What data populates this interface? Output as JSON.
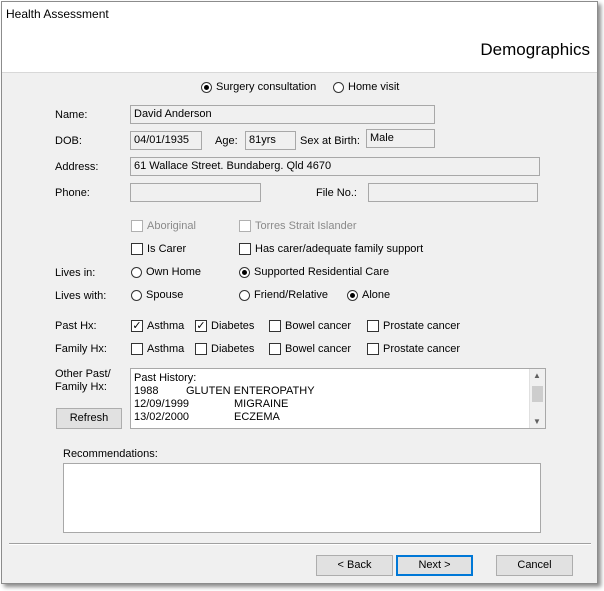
{
  "window": {
    "title": "Health Assessment",
    "header": "Demographics"
  },
  "consult": {
    "surgery": "Surgery consultation",
    "home": "Home visit"
  },
  "labels": {
    "name": "Name:",
    "dob": "DOB:",
    "age": "Age:",
    "sex": "Sex at Birth:",
    "address": "Address:",
    "phone": "Phone:",
    "file_no": "File No.:",
    "lives_in": "Lives in:",
    "lives_with": "Lives with:",
    "past_hx": "Past Hx:",
    "family_hx": "Family Hx:",
    "other_past_1": "Other Past/",
    "other_past_2": "Family Hx:",
    "recommendations": "Recommendations:"
  },
  "fields": {
    "name": "David Anderson",
    "dob": "04/01/1935",
    "age": "81yrs",
    "sex": "Male",
    "address": "61 Wallace Street. Bundaberg. Qld  4670",
    "phone": "",
    "file_no": ""
  },
  "checks": {
    "aboriginal": "Aboriginal",
    "torres": "Torres Strait Islander",
    "is_carer": "Is Carer",
    "has_carer": "Has carer/adequate family support"
  },
  "lives_in": {
    "own_home": "Own Home",
    "supported": "Supported Residential Care"
  },
  "lives_with": {
    "spouse": "Spouse",
    "friend": "Friend/Relative",
    "alone": "Alone"
  },
  "conditions": {
    "asthma": "Asthma",
    "diabetes": "Diabetes",
    "bowel": "Bowel cancer",
    "prostate": "Prostate cancer"
  },
  "other_history": {
    "heading": "Past History:",
    "rows": [
      {
        "date": "1988",
        "condition": "GLUTEN ENTEROPATHY"
      },
      {
        "date": "12/09/1999",
        "condition": "MIGRAINE"
      },
      {
        "date": "13/02/2000",
        "condition": "ECZEMA"
      }
    ]
  },
  "buttons": {
    "refresh": "Refresh",
    "back": "< Back",
    "next": "Next >",
    "cancel": "Cancel"
  }
}
